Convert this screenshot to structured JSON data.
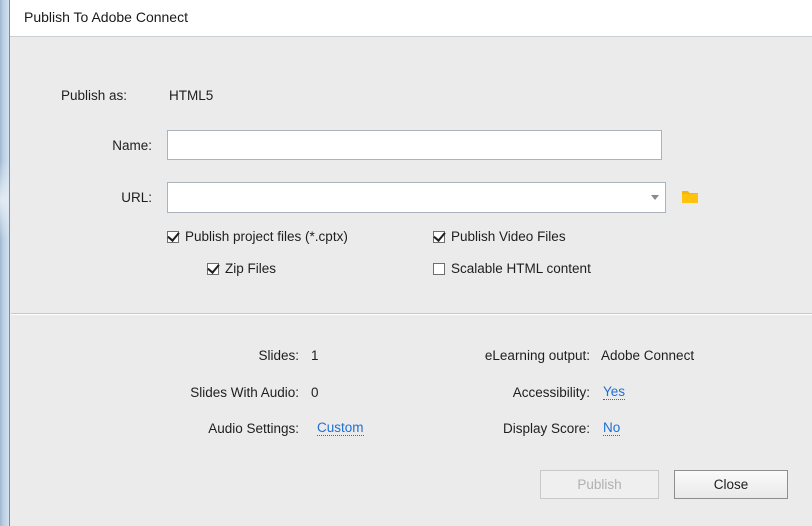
{
  "window": {
    "title": "Publish To Adobe Connect"
  },
  "publish_as": {
    "label": "Publish as:",
    "value": "HTML5"
  },
  "name_field": {
    "label": "Name:",
    "value": ""
  },
  "url_field": {
    "label": "URL:",
    "value": ""
  },
  "options": {
    "publish_project_files": {
      "label": "Publish project files (*.cptx)",
      "checked": true
    },
    "zip_files": {
      "label": "Zip Files",
      "checked": true
    },
    "publish_video_files": {
      "label": "Publish Video Files",
      "checked": true
    },
    "scalable_html": {
      "label": "Scalable HTML content",
      "checked": false
    }
  },
  "info": {
    "slides": {
      "label": "Slides:",
      "value": "1"
    },
    "slides_with_audio": {
      "label": "Slides With Audio:",
      "value": "0"
    },
    "audio_settings": {
      "label": "Audio Settings:",
      "value": "Custom"
    },
    "elearning_output": {
      "label": "eLearning output:",
      "value": "Adobe Connect"
    },
    "accessibility": {
      "label": "Accessibility:",
      "value": "Yes"
    },
    "display_score": {
      "label": "Display Score:",
      "value": "No"
    }
  },
  "buttons": {
    "publish": "Publish",
    "close": "Close"
  },
  "icons": {
    "browse": "folder-icon",
    "dropdown": "chevron-down-icon"
  },
  "colors": {
    "link": "#1f6fd1",
    "folder": "#f5b800",
    "background": "#ebebeb"
  }
}
